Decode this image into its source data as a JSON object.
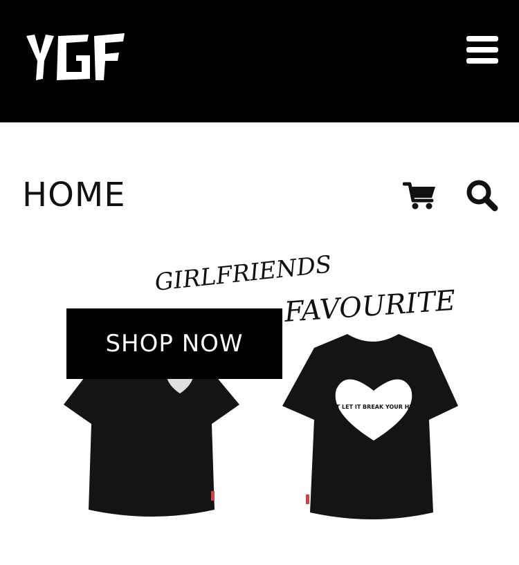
{
  "header": {
    "logo_text": "YGF",
    "menu_icon": "hamburger-menu-icon",
    "background": "#000000"
  },
  "page": {
    "title": "HOME",
    "cart_icon": "shopping-cart-icon",
    "search_icon": "search-icon"
  },
  "hero": {
    "artwork_text_line1": "GIRLFRIENDS",
    "artwork_text_line2": "FAVOURITE",
    "shirt_print_text": "DONT LET IT BREAK YOUR HEART",
    "cta_label": "SHOP NOW",
    "cta_background": "#000000",
    "cta_color": "#ffffff"
  }
}
